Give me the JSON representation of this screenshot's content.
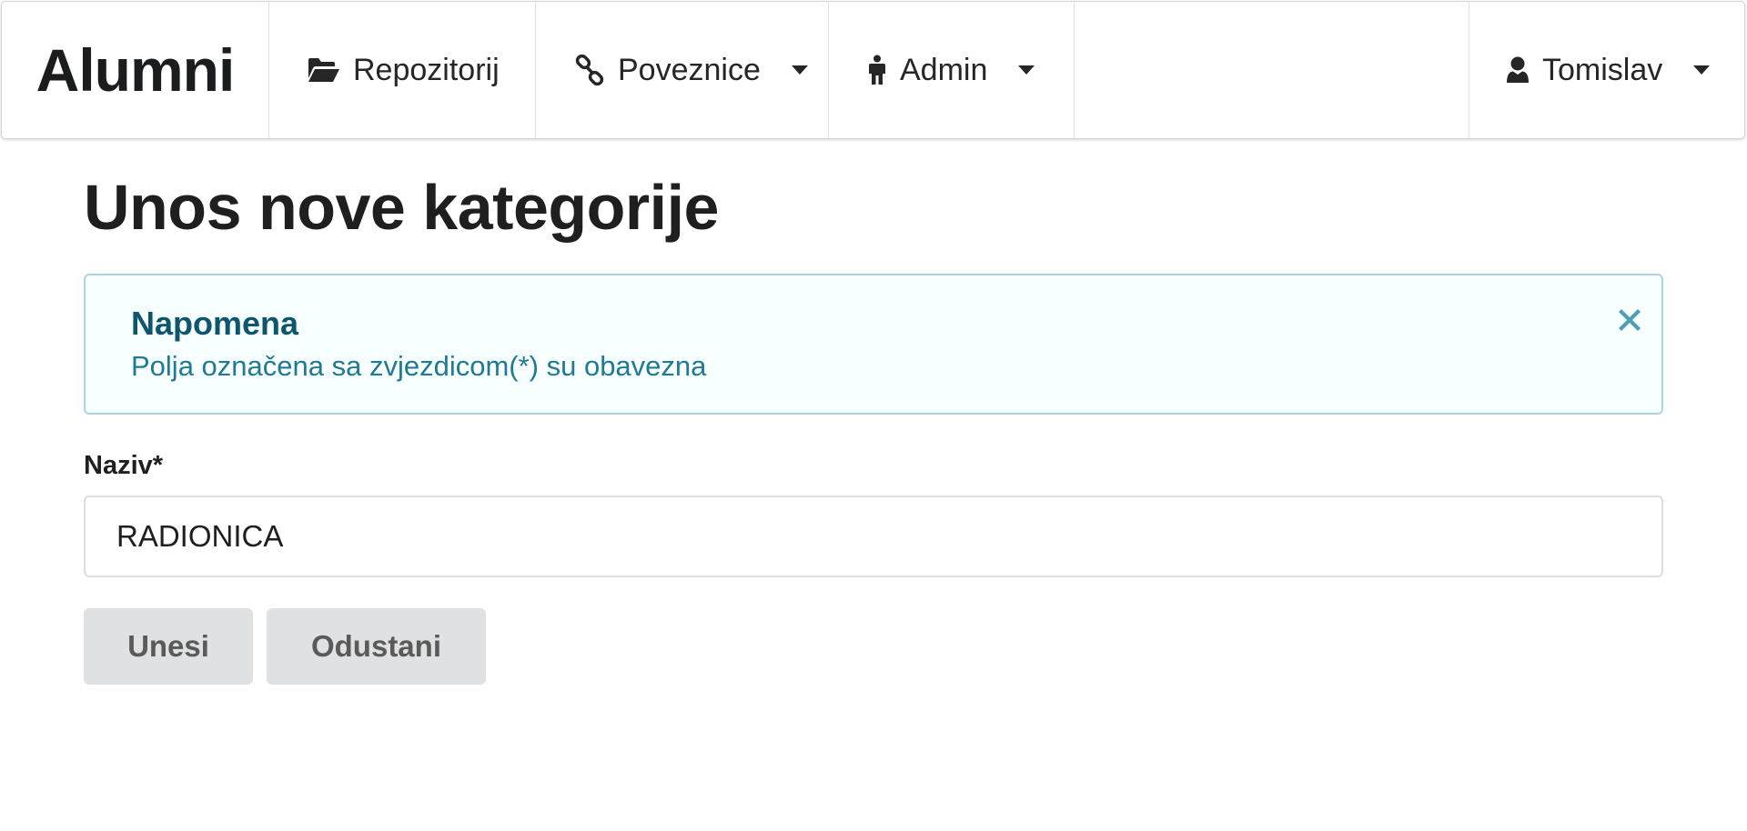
{
  "menu": {
    "brand": "Alumni",
    "items": [
      {
        "label": "Repozitorij",
        "icon": "folder-open-icon",
        "dropdown": false
      },
      {
        "label": "Poveznice",
        "icon": "link-icon",
        "dropdown": true
      },
      {
        "label": "Admin",
        "icon": "male-icon",
        "dropdown": true
      }
    ],
    "user": {
      "label": "Tomislav",
      "icon": "user-icon",
      "dropdown": true
    }
  },
  "page": {
    "title": "Unos nove kategorije"
  },
  "notice": {
    "header": "Napomena",
    "text": "Polja označena sa zvjezdicom(*) su obavezna",
    "close_icon": "close-icon"
  },
  "form": {
    "name_label": "Naziv*",
    "name_value": "RADIONICA",
    "submit_label": "Unesi",
    "cancel_label": "Odustani"
  },
  "colors": {
    "notice_background": "#f8ffff",
    "notice_border": "#a9d5de",
    "notice_text": "#276f86",
    "button_background": "#e0e1e2"
  }
}
